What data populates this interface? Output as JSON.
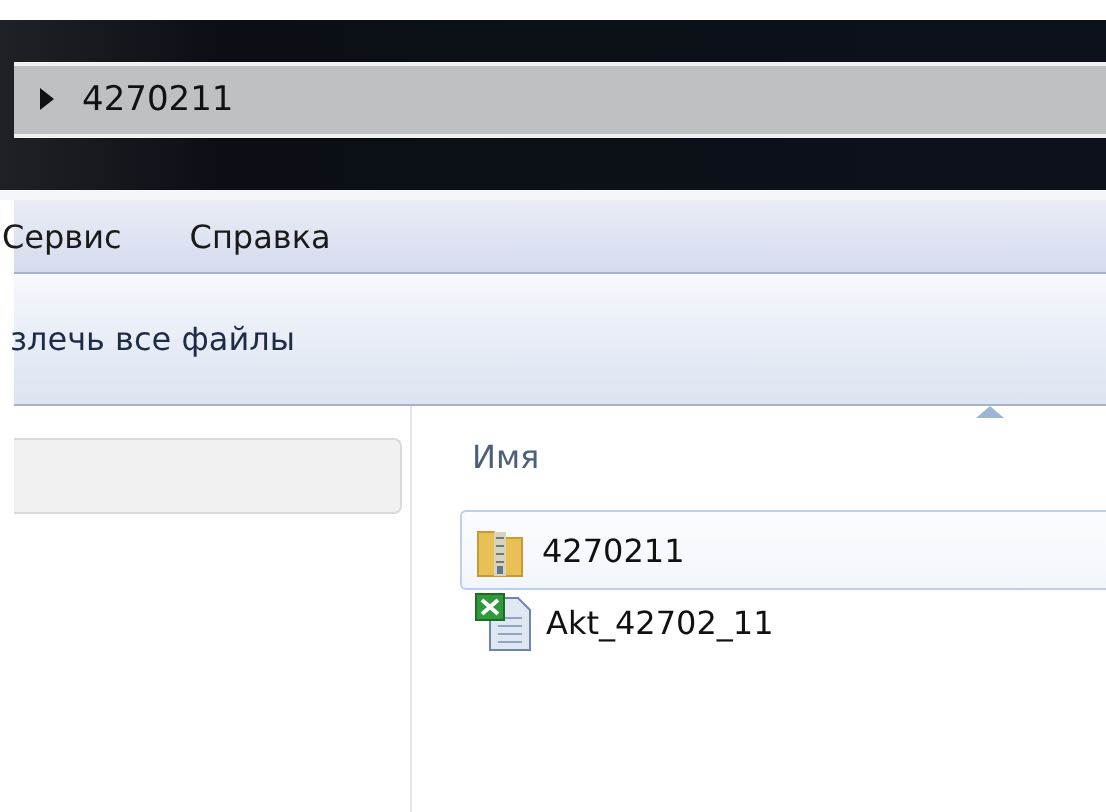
{
  "address_bar": {
    "crumbs": [
      "4270211"
    ]
  },
  "menu_bar": {
    "items": [
      "Сервис",
      "Справка"
    ]
  },
  "toolbar": {
    "buttons": [
      "злечь все файлы"
    ]
  },
  "file_list": {
    "columns": [
      "Имя"
    ],
    "rows": [
      {
        "name": "4270211",
        "kind": "zip",
        "selected": true
      },
      {
        "name": "Akt_42702_11",
        "kind": "excel",
        "selected": false
      }
    ]
  }
}
